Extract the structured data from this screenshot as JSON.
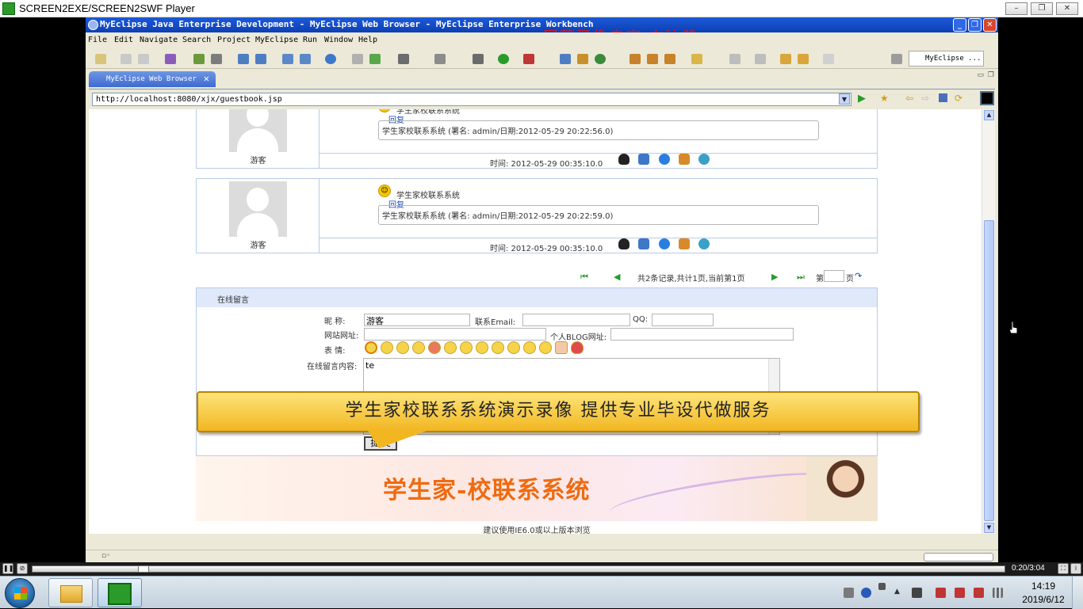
{
  "player": {
    "title": "SCREEN2EXE/SCREEN2SWF Player",
    "timecode": "0:20/3:04",
    "seek_progress": 0.11
  },
  "eclipse": {
    "title": "MyEclipse Java Enterprise Development - MyEclipse Web Browser - MyEclipse Enterprise Workbench",
    "watermark": "屏幕录像专家 未注册",
    "menu": [
      "File",
      "Edit",
      "Navigate",
      "Search",
      "Project",
      "MyEclipse",
      "Run",
      "Window",
      "Help"
    ],
    "perspective_label": "MyEclipse ...",
    "tab_label": "MyEclipse Web Browser",
    "url": "http://localhost:8080/xjx/guestbook.jsp"
  },
  "guestbook": {
    "entries": [
      {
        "name": "游客",
        "subject": "学生家校联系系统",
        "reply_link": "回复",
        "reply_text": "学生家校联系系统 (署名: admin/日期:2012-05-29 20:22:56.0)",
        "time": "时间: 2012-05-29 00:35:10.0"
      },
      {
        "name": "游客",
        "subject": "学生家校联系系统",
        "reply_link": "回复",
        "reply_text": "学生家校联系系统 (署名: admin/日期:2012-05-29 20:22:59.0)",
        "time": "时间: 2012-05-29 00:35:10.0"
      }
    ],
    "pager": {
      "summary": "共2条记录,共计1页,当前第1页",
      "page_prefix": "第",
      "page_suffix": "页"
    }
  },
  "form": {
    "header": "在线留言",
    "nickname_label": "昵  称:",
    "nickname_value": "游客",
    "email_label": "联系Email:",
    "qq_label": "QQ:",
    "website_label": "网站网址:",
    "blog_label": "个人BLOG网址:",
    "emotion_label": "表  情:",
    "content_label": "在线留言内容:",
    "content_value": "te",
    "submit_label": "提 交"
  },
  "callout": "学生家校联系系统演示录像 提供专业毕设代做服务",
  "banner": {
    "title": "学生家-校联系系统",
    "browse_note": "建议使用IE6.0或以上版本浏览"
  },
  "taskbar": {
    "time": "14:19",
    "date": "2019/6/12"
  }
}
